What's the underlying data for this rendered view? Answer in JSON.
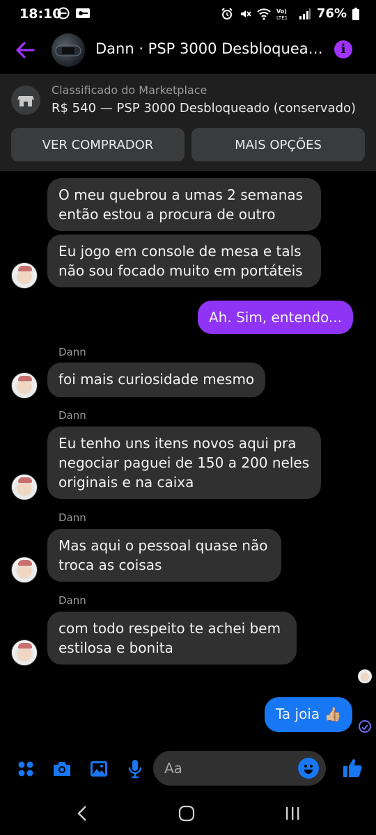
{
  "status_bar": {
    "time": "18:10",
    "battery": "76%",
    "network_label": "Vo) LTE1"
  },
  "header": {
    "title": "Dann · PSP 3000 Desbloqueado (conservado)",
    "back_icon": "back-arrow-icon",
    "info_icon": "info-icon",
    "info_glyph": "i",
    "accent_color": "#a033ff"
  },
  "marketplace": {
    "label": "Classificado do Marketplace",
    "item": "R$ 540 — PSP 3000 Desbloqueado (conservado)",
    "view_buyer": "VER COMPRADOR",
    "more_options": "MAIS OPÇÕES"
  },
  "messages": [
    {
      "text": "O meu quebrou a umas 2 semanas então  estou a procura de outro",
      "direction": "in"
    },
    {
      "text": "Eu jogo em console de mesa e tals não sou focado muito em portáteis",
      "direction": "in"
    },
    {
      "text": "Ah. Sim, entendo...",
      "direction": "out"
    },
    {
      "sender": "Dann",
      "text": "foi mais curiosidade  mesmo",
      "direction": "in"
    },
    {
      "sender": "Dann",
      "text": "Eu tenho uns itens  novos aqui pra negociar  paguei de 150 a 200 neles originais e na caixa",
      "direction": "in"
    },
    {
      "sender": "Dann",
      "text": "Mas aqui o pessoal  quase não troca as coisas",
      "direction": "in"
    },
    {
      "sender": "Dann",
      "text": "com todo respeito te  achei bem estilosa  e bonita",
      "direction": "in"
    },
    {
      "text": "Ta joia 👍🏼",
      "direction": "out"
    }
  ],
  "composer": {
    "placeholder": "Aa"
  },
  "colors": {
    "bubble_in": "#303030",
    "bubble_out_purple": "#8f34f5",
    "bubble_out_blue": "#1877f2",
    "icon_blue": "#1877f2"
  }
}
